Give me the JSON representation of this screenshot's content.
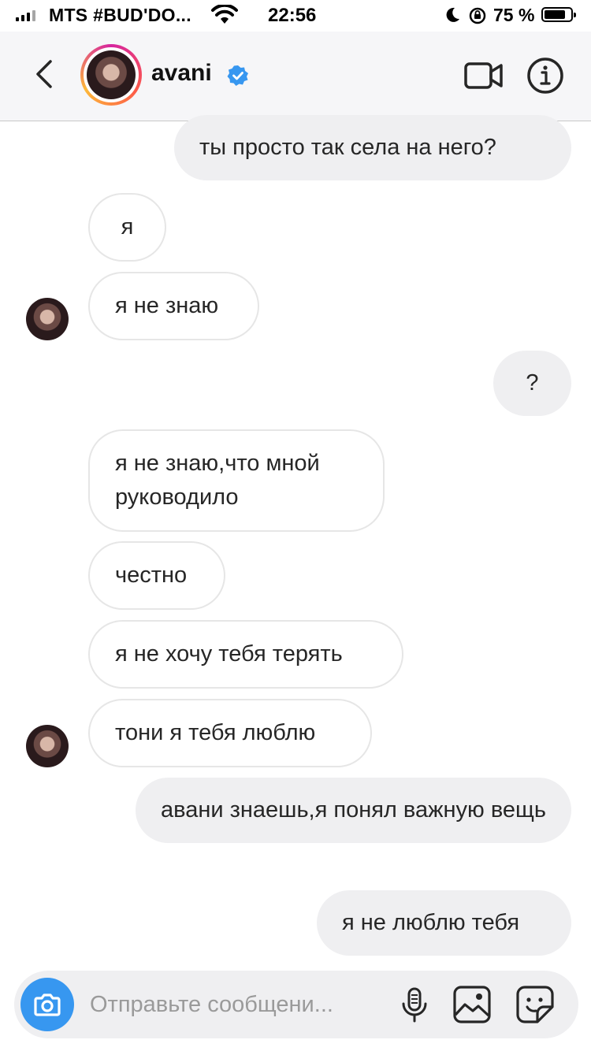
{
  "status_bar": {
    "carrier": "MTS #BUD'DO...",
    "time": "22:56",
    "battery_text": "75 %",
    "battery_level": 0.75
  },
  "header": {
    "username": "avani",
    "verified": true,
    "icons": [
      "back-icon",
      "video-call-icon",
      "info-icon"
    ]
  },
  "messages": [
    {
      "side": "out",
      "text": "ты просто так села на него?"
    },
    {
      "side": "in",
      "text": "я"
    },
    {
      "side": "in",
      "text": "я не знаю"
    },
    {
      "side": "out",
      "text": "?"
    },
    {
      "side": "in",
      "text": "я не знаю,что мной руководило"
    },
    {
      "side": "in",
      "text": "честно"
    },
    {
      "side": "in",
      "text": "я не хочу тебя терять"
    },
    {
      "side": "in",
      "text": "тони я тебя люблю"
    },
    {
      "side": "out",
      "text": "авани знаешь,я понял важную вещь"
    },
    {
      "side": "out",
      "text": "я не люблю тебя"
    }
  ],
  "composer": {
    "placeholder": "Отправьте сообщени...",
    "icons": [
      "camera-icon",
      "microphone-icon",
      "gallery-icon",
      "sticker-icon"
    ]
  },
  "colors": {
    "accent": "#3797f0",
    "outgoing_bubble": "#efeff1",
    "incoming_border": "#e6e6e6"
  }
}
